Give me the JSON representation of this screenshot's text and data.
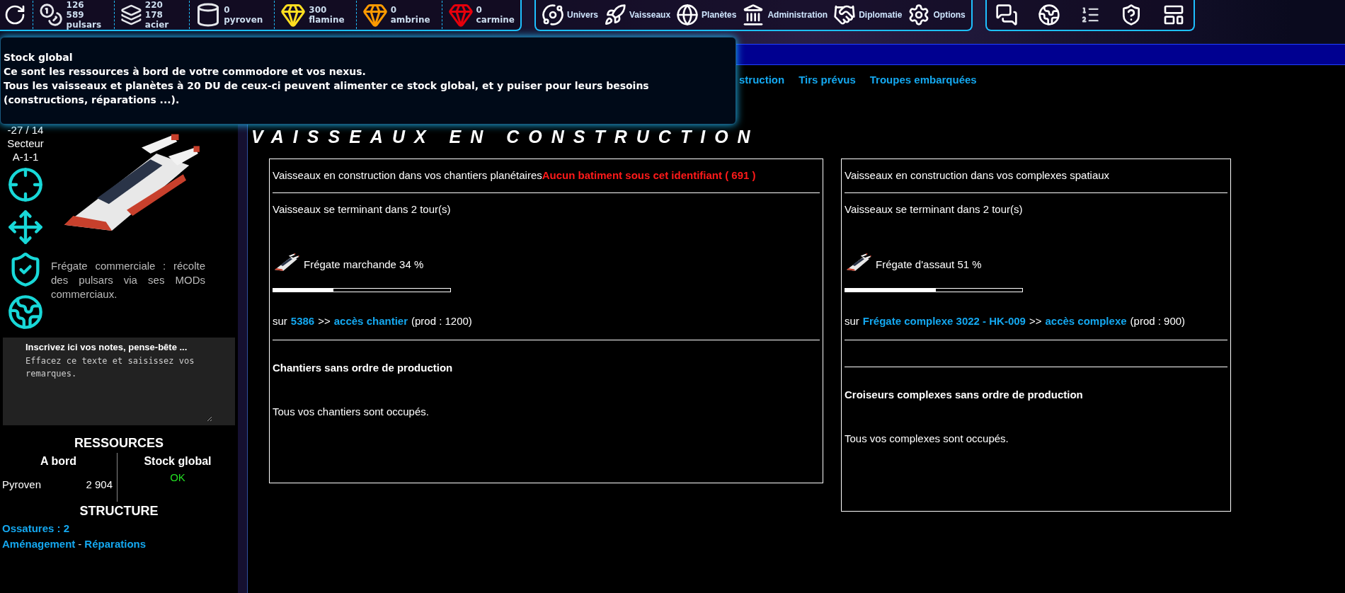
{
  "resources": [
    {
      "value": "126 589",
      "name": "pulsars"
    },
    {
      "value": "220 178",
      "name": "acier"
    },
    {
      "value": "0",
      "name": "pyroven"
    },
    {
      "value": "300",
      "name": "flamine"
    },
    {
      "value": "0",
      "name": "ambrine"
    },
    {
      "value": "0",
      "name": "carmine"
    }
  ],
  "nav": [
    "Univers",
    "Vaisseaux",
    "Planètes",
    "Administration",
    "Diplomatie",
    "Options"
  ],
  "tooltip": {
    "title": "Stock global",
    "lines": [
      "Ce sont les ressources à bord de votre commodore et vos nexus.",
      "Tous les vaisseaux et planètes à 20 DU de ceux-ci peuvent alimenter ce stock global, et y puiser pour leurs besoins (constructions, réparations ...)."
    ]
  },
  "position": [
    "-27 / 14",
    "Secteur",
    "A-1-1"
  ],
  "ship_description": "Frégate commerciale : récolte des pulsars via ses MODs commerciaux.",
  "notes": {
    "label": "Inscrivez ici vos notes, pense-bête ...",
    "value": "Effacez ce texte et saisissez vos remarques."
  },
  "resources_panel": {
    "title": "RESSOURCES",
    "on_board": "A bord",
    "global": "Stock global",
    "global_status": "OK",
    "items": [
      {
        "name": "Pyroven",
        "value": "2 904"
      }
    ]
  },
  "structure": {
    "title": "STRUCTURE",
    "frames": "Ossatures : 2",
    "links": [
      "Aménagement",
      "Réparations"
    ],
    "separator": "-"
  },
  "tabs": [
    "struction",
    "Tirs prévus",
    "Troupes embarquées"
  ],
  "page_title": "VAISSEAUX EN CONSTRUCTION",
  "panels": [
    {
      "title": "Vaisseaux en construction dans vos chantiers planétaires",
      "error": "Aucun batiment sous cet identifiant ( 691 )",
      "subtitle": "Vaisseaux se terminant dans 2 tour(s)",
      "ship": "Frégate marchande 34 %",
      "level": 0.34,
      "location": [
        {
          "kind": "text",
          "text": "sur"
        },
        {
          "kind": "link",
          "text": "5386"
        },
        {
          "kind": "text",
          "text": ">>"
        },
        {
          "kind": "link",
          "text": "accès chantier"
        },
        {
          "kind": "text",
          "text": "(prod : 1200)"
        }
      ],
      "idle_title": "Chantiers sans ordre de production",
      "idle_text": "Tous vos chantiers sont occupés."
    },
    {
      "title": "Vaisseaux en construction dans vos complexes spatiaux",
      "subtitle": "Vaisseaux se terminant dans 2 tour(s)",
      "ship": "Frégate d'assaut 51 %",
      "level": 0.51,
      "location": [
        {
          "kind": "text",
          "text": "sur"
        },
        {
          "kind": "link",
          "text": "Frégate complexe 3022 - HK-009"
        },
        {
          "kind": "text",
          "text": ">>"
        },
        {
          "kind": "link",
          "text": "accès complexe"
        },
        {
          "kind": "text",
          "text": "(prod : 900)"
        }
      ],
      "idle_title": "Croiseurs complexes sans ordre de production",
      "idle_text": "Tous vos complexes sont occupés."
    }
  ]
}
